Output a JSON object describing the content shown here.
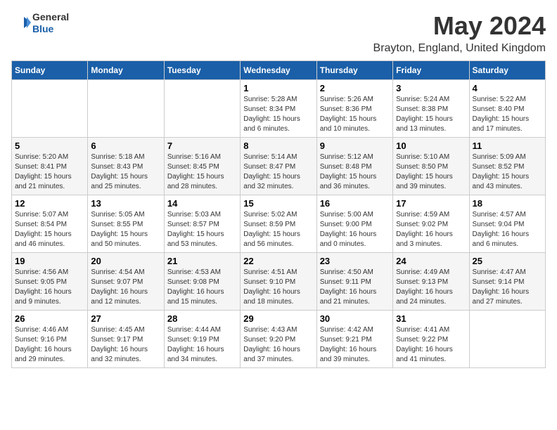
{
  "logo": {
    "general": "General",
    "blue": "Blue"
  },
  "title": "May 2024",
  "location": "Brayton, England, United Kingdom",
  "days_of_week": [
    "Sunday",
    "Monday",
    "Tuesday",
    "Wednesday",
    "Thursday",
    "Friday",
    "Saturday"
  ],
  "weeks": [
    [
      {
        "day": "",
        "info": ""
      },
      {
        "day": "",
        "info": ""
      },
      {
        "day": "",
        "info": ""
      },
      {
        "day": "1",
        "info": "Sunrise: 5:28 AM\nSunset: 8:34 PM\nDaylight: 15 hours\nand 6 minutes."
      },
      {
        "day": "2",
        "info": "Sunrise: 5:26 AM\nSunset: 8:36 PM\nDaylight: 15 hours\nand 10 minutes."
      },
      {
        "day": "3",
        "info": "Sunrise: 5:24 AM\nSunset: 8:38 PM\nDaylight: 15 hours\nand 13 minutes."
      },
      {
        "day": "4",
        "info": "Sunrise: 5:22 AM\nSunset: 8:40 PM\nDaylight: 15 hours\nand 17 minutes."
      }
    ],
    [
      {
        "day": "5",
        "info": "Sunrise: 5:20 AM\nSunset: 8:41 PM\nDaylight: 15 hours\nand 21 minutes."
      },
      {
        "day": "6",
        "info": "Sunrise: 5:18 AM\nSunset: 8:43 PM\nDaylight: 15 hours\nand 25 minutes."
      },
      {
        "day": "7",
        "info": "Sunrise: 5:16 AM\nSunset: 8:45 PM\nDaylight: 15 hours\nand 28 minutes."
      },
      {
        "day": "8",
        "info": "Sunrise: 5:14 AM\nSunset: 8:47 PM\nDaylight: 15 hours\nand 32 minutes."
      },
      {
        "day": "9",
        "info": "Sunrise: 5:12 AM\nSunset: 8:48 PM\nDaylight: 15 hours\nand 36 minutes."
      },
      {
        "day": "10",
        "info": "Sunrise: 5:10 AM\nSunset: 8:50 PM\nDaylight: 15 hours\nand 39 minutes."
      },
      {
        "day": "11",
        "info": "Sunrise: 5:09 AM\nSunset: 8:52 PM\nDaylight: 15 hours\nand 43 minutes."
      }
    ],
    [
      {
        "day": "12",
        "info": "Sunrise: 5:07 AM\nSunset: 8:54 PM\nDaylight: 15 hours\nand 46 minutes."
      },
      {
        "day": "13",
        "info": "Sunrise: 5:05 AM\nSunset: 8:55 PM\nDaylight: 15 hours\nand 50 minutes."
      },
      {
        "day": "14",
        "info": "Sunrise: 5:03 AM\nSunset: 8:57 PM\nDaylight: 15 hours\nand 53 minutes."
      },
      {
        "day": "15",
        "info": "Sunrise: 5:02 AM\nSunset: 8:59 PM\nDaylight: 15 hours\nand 56 minutes."
      },
      {
        "day": "16",
        "info": "Sunrise: 5:00 AM\nSunset: 9:00 PM\nDaylight: 16 hours\nand 0 minutes."
      },
      {
        "day": "17",
        "info": "Sunrise: 4:59 AM\nSunset: 9:02 PM\nDaylight: 16 hours\nand 3 minutes."
      },
      {
        "day": "18",
        "info": "Sunrise: 4:57 AM\nSunset: 9:04 PM\nDaylight: 16 hours\nand 6 minutes."
      }
    ],
    [
      {
        "day": "19",
        "info": "Sunrise: 4:56 AM\nSunset: 9:05 PM\nDaylight: 16 hours\nand 9 minutes."
      },
      {
        "day": "20",
        "info": "Sunrise: 4:54 AM\nSunset: 9:07 PM\nDaylight: 16 hours\nand 12 minutes."
      },
      {
        "day": "21",
        "info": "Sunrise: 4:53 AM\nSunset: 9:08 PM\nDaylight: 16 hours\nand 15 minutes."
      },
      {
        "day": "22",
        "info": "Sunrise: 4:51 AM\nSunset: 9:10 PM\nDaylight: 16 hours\nand 18 minutes."
      },
      {
        "day": "23",
        "info": "Sunrise: 4:50 AM\nSunset: 9:11 PM\nDaylight: 16 hours\nand 21 minutes."
      },
      {
        "day": "24",
        "info": "Sunrise: 4:49 AM\nSunset: 9:13 PM\nDaylight: 16 hours\nand 24 minutes."
      },
      {
        "day": "25",
        "info": "Sunrise: 4:47 AM\nSunset: 9:14 PM\nDaylight: 16 hours\nand 27 minutes."
      }
    ],
    [
      {
        "day": "26",
        "info": "Sunrise: 4:46 AM\nSunset: 9:16 PM\nDaylight: 16 hours\nand 29 minutes."
      },
      {
        "day": "27",
        "info": "Sunrise: 4:45 AM\nSunset: 9:17 PM\nDaylight: 16 hours\nand 32 minutes."
      },
      {
        "day": "28",
        "info": "Sunrise: 4:44 AM\nSunset: 9:19 PM\nDaylight: 16 hours\nand 34 minutes."
      },
      {
        "day": "29",
        "info": "Sunrise: 4:43 AM\nSunset: 9:20 PM\nDaylight: 16 hours\nand 37 minutes."
      },
      {
        "day": "30",
        "info": "Sunrise: 4:42 AM\nSunset: 9:21 PM\nDaylight: 16 hours\nand 39 minutes."
      },
      {
        "day": "31",
        "info": "Sunrise: 4:41 AM\nSunset: 9:22 PM\nDaylight: 16 hours\nand 41 minutes."
      },
      {
        "day": "",
        "info": ""
      }
    ]
  ]
}
